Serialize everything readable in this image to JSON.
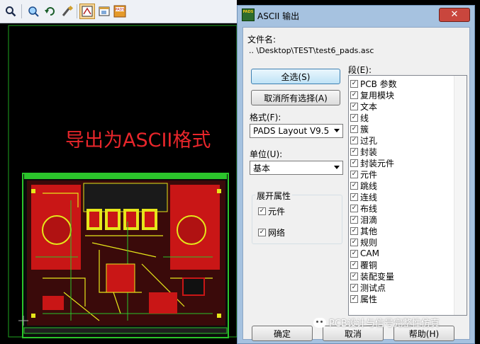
{
  "toolbar": {
    "icons": [
      "search-icon",
      "zoom-icon",
      "undo-icon",
      "brush-icon",
      "pcb-icon",
      "window-icon",
      "pads-logo-icon"
    ]
  },
  "overlay_text": "导出为ASCII格式",
  "dialog": {
    "app_logo": "PADS",
    "title": "ASCII 输出",
    "close_label": "✕",
    "file_label": "文件名:",
    "file_path": "..                                   \\Desktop\\TEST\\test6_pads.asc",
    "select_all": "全选(S)",
    "deselect_all": "取消所有选择(A)",
    "format_label": "格式(F):",
    "format_value": "PADS Layout V9.5",
    "unit_label": "单位(U):",
    "unit_value": "基本",
    "expand_group": "展开属性",
    "expand_items": [
      {
        "label": "元件",
        "checked": true
      },
      {
        "label": "网络",
        "checked": true
      }
    ],
    "sections_label": "段(E):",
    "sections": [
      {
        "label": "PCB 参数"
      },
      {
        "label": "复用模块"
      },
      {
        "label": "文本"
      },
      {
        "label": "线"
      },
      {
        "label": "簇"
      },
      {
        "label": "过孔"
      },
      {
        "label": "封装"
      },
      {
        "label": "封装元件"
      },
      {
        "label": "元件"
      },
      {
        "label": "跳线"
      },
      {
        "label": "连线"
      },
      {
        "label": "布线"
      },
      {
        "label": "泪滴"
      },
      {
        "label": "其他"
      },
      {
        "label": "规则"
      },
      {
        "label": "CAM"
      },
      {
        "label": "覆铜"
      },
      {
        "label": "装配变量"
      },
      {
        "label": "测试点"
      },
      {
        "label": "属性"
      }
    ],
    "ok": "确定",
    "cancel": "取消",
    "help": "帮助(H)"
  },
  "watermark": "PCB设计与信号完整性仿真",
  "colors": {
    "pcb_red": "#e01a1a",
    "pcb_green": "#2bc42b",
    "pcb_yellow": "#e6e61a",
    "dialog_frame": "#a6c2e0",
    "overlay_text": "#e8262b"
  }
}
